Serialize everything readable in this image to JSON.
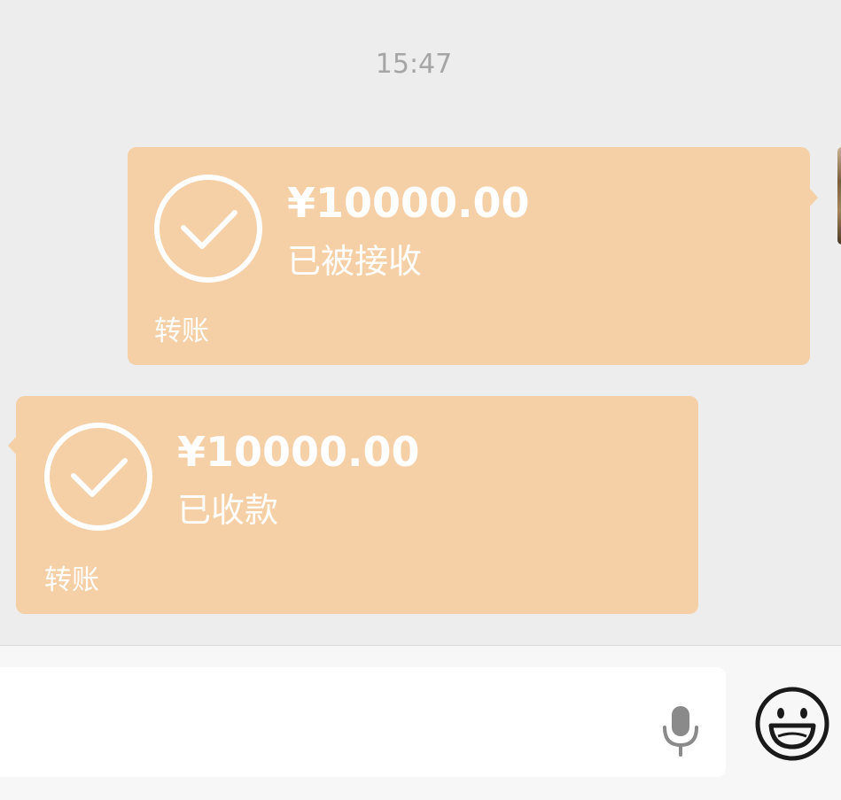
{
  "timestamp": "15:47",
  "messages": [
    {
      "side": "right",
      "amount": "¥10000.00",
      "status": "已被接收",
      "label": "转账",
      "icon": "check-circle-icon"
    },
    {
      "side": "left",
      "amount": "¥10000.00",
      "status": "已收款",
      "label": "转账",
      "icon": "check-circle-icon"
    }
  ],
  "input_bar": {
    "value": "",
    "mic_icon": "microphone-icon",
    "emoji_icon": "emoji-smile-icon"
  },
  "colors": {
    "chat_background": "#ededed",
    "bubble": "#f5cfa5",
    "bubble_text": "#ffffff",
    "timestamp_text": "#a5a5a5",
    "input_bar_background": "#f7f7f7",
    "input_field_background": "#ffffff"
  }
}
